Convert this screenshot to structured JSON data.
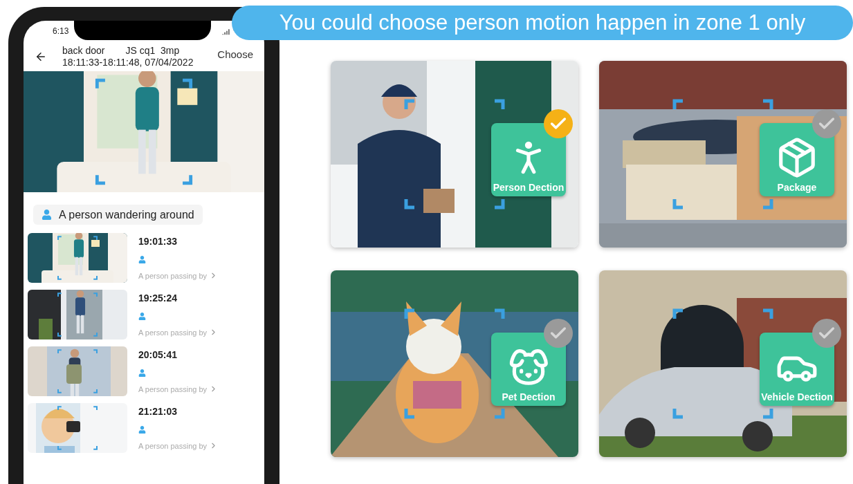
{
  "callout": "You could choose person motion happen in zone 1 only",
  "phone": {
    "status_time": "6:13",
    "header": {
      "device": "back door",
      "camera": "JS cq1  3mp",
      "time_range": "18:11:33-18:11:48, 07/04/2022",
      "action": "Choose"
    },
    "event_label": "A person wandering around",
    "events": [
      {
        "time": "19:01:33",
        "description": "A person passing by"
      },
      {
        "time": "19:25:24",
        "description": "A person passing by"
      },
      {
        "time": "20:05:41",
        "description": "A person passing by"
      },
      {
        "time": "21:21:03",
        "description": "A person passing by"
      }
    ]
  },
  "detections": [
    {
      "kind": "person",
      "label": "Person Dection",
      "selected": true
    },
    {
      "kind": "package",
      "label": "Package",
      "selected": false
    },
    {
      "kind": "pet",
      "label": "Pet Dection",
      "selected": false
    },
    {
      "kind": "vehicle",
      "label": "Vehicle Dection",
      "selected": false
    }
  ]
}
